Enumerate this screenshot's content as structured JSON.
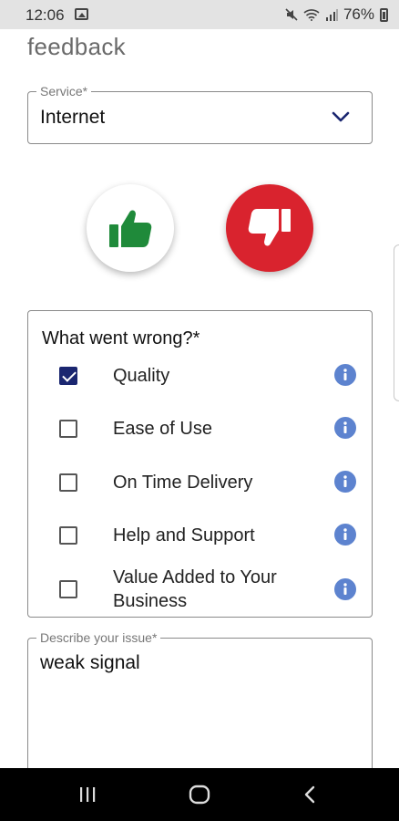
{
  "status_bar": {
    "time": "12:06",
    "battery_percent": "76%",
    "icons": [
      "image-icon",
      "mute-icon",
      "wifi-icon",
      "signal-icon",
      "battery-icon"
    ]
  },
  "page": {
    "title": "feedback"
  },
  "service": {
    "label": "Service*",
    "value": "Internet"
  },
  "rating": {
    "thumb_up_color": "#1f8a3a",
    "thumb_down_color": "#d9232e"
  },
  "what_went_wrong": {
    "title": "What went wrong?*",
    "options": [
      {
        "label": "Quality",
        "checked": true
      },
      {
        "label": "Ease of Use",
        "checked": false
      },
      {
        "label": "On Time Delivery",
        "checked": false
      },
      {
        "label": "Help and Support",
        "checked": false
      },
      {
        "label": "Value Added to Your Business",
        "checked": false
      }
    ]
  },
  "issue": {
    "label": "Describe your issue*",
    "value": "weak signal"
  },
  "colors": {
    "accent": "#1a2670",
    "info": "#5d83cf"
  }
}
